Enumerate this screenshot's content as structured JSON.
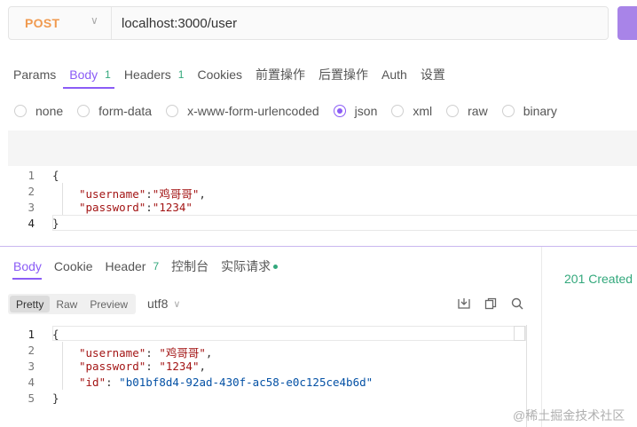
{
  "request": {
    "method": "POST",
    "url": "localhost:3000/user",
    "tabs": [
      {
        "label": "Params",
        "count": ""
      },
      {
        "label": "Body",
        "count": "1"
      },
      {
        "label": "Headers",
        "count": "1"
      },
      {
        "label": "Cookies",
        "count": ""
      },
      {
        "label": "前置操作",
        "count": ""
      },
      {
        "label": "后置操作",
        "count": ""
      },
      {
        "label": "Auth",
        "count": ""
      },
      {
        "label": "设置",
        "count": ""
      }
    ],
    "active_tab": "Body",
    "body_types": [
      "none",
      "form-data",
      "x-www-form-urlencoded",
      "json",
      "xml",
      "raw",
      "binary"
    ],
    "selected_body_type": "json",
    "body_lines": [
      {
        "num": "1",
        "text": "{"
      },
      {
        "num": "2",
        "key": "\"username\"",
        "sep": ":",
        "value": "\"鸡哥哥\"",
        "end": ","
      },
      {
        "num": "3",
        "key": "\"password\"",
        "sep": ":",
        "value": "\"1234\"",
        "end": ""
      },
      {
        "num": "4",
        "text": "}"
      }
    ]
  },
  "response": {
    "tabs": [
      {
        "label": "Body",
        "count": ""
      },
      {
        "label": "Cookie",
        "count": ""
      },
      {
        "label": "Header",
        "count": "7"
      },
      {
        "label": "控制台",
        "count": ""
      },
      {
        "label": "实际请求",
        "count": ""
      }
    ],
    "active_tab": "Body",
    "status": "201 Created",
    "view_modes": [
      "Pretty",
      "Raw",
      "Preview"
    ],
    "active_view_mode": "Pretty",
    "encoding": "utf8",
    "body_lines": [
      {
        "num": "1",
        "text": "{"
      },
      {
        "num": "2",
        "key": "\"username\"",
        "sep": ": ",
        "value": "\"鸡哥哥\"",
        "end": ","
      },
      {
        "num": "3",
        "key": "\"password\"",
        "sep": ": ",
        "value": "\"1234\"",
        "end": ","
      },
      {
        "num": "4",
        "key": "\"id\"",
        "sep": ": ",
        "value": "\"b01bf8d4-92ad-430f-ac58-e0c125ce4b6d\"",
        "end": ""
      },
      {
        "num": "5",
        "text": "}"
      }
    ]
  },
  "watermark": "@稀土掘金技术社区",
  "colors": {
    "accent": "#8b5cf6",
    "method": "#f09a4f",
    "success": "#33a87c"
  }
}
